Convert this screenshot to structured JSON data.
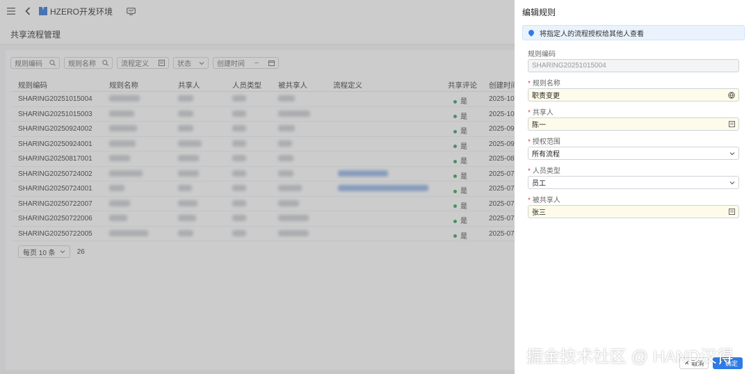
{
  "topbar": {
    "env_name": "HZERO开发环境"
  },
  "page": {
    "title": "共享流程管理"
  },
  "filters": [
    {
      "label": "规则编码",
      "icon": "search-icon"
    },
    {
      "label": "规则名称",
      "icon": "search-icon"
    },
    {
      "label": "流程定义",
      "icon": "lookup-icon"
    },
    {
      "label": "状态",
      "icon": "chevron-down-icon"
    },
    {
      "label": "创建时间",
      "separator": "–",
      "icon": "calendar-icon"
    }
  ],
  "table": {
    "columns": [
      "规则编码",
      "规则名称",
      "共享人",
      "人员类型",
      "被共享人",
      "流程定义",
      "共享评论",
      "创建时间"
    ],
    "rows": [
      {
        "code": "SHARING20251015004",
        "comment": "是",
        "created": "2025-10-"
      },
      {
        "code": "SHARING20251015003",
        "comment": "是",
        "created": "2025-10-"
      },
      {
        "code": "SHARING20250924002",
        "comment": "是",
        "created": "2025-09-"
      },
      {
        "code": "SHARING20250924001",
        "comment": "是",
        "created": "2025-09-"
      },
      {
        "code": "SHARING20250817001",
        "comment": "是",
        "created": "2025-08-"
      },
      {
        "code": "SHARING20250724002",
        "comment": "是",
        "created": "2025-07-"
      },
      {
        "code": "SHARING20250724001",
        "comment": "是",
        "created": "2025-07-"
      },
      {
        "code": "SHARING20250722007",
        "comment": "是",
        "created": "2025-07-"
      },
      {
        "code": "SHARING20250722006",
        "comment": "是",
        "created": "2025-07-"
      },
      {
        "code": "SHARING20250722005",
        "comment": "是",
        "created": "2025-07-"
      }
    ]
  },
  "pagination": {
    "page_size_label": "每页 10 条",
    "total": "26"
  },
  "drawer": {
    "title": "编辑规则",
    "notice": "将指定人的流程授权给其他人查看",
    "fields": [
      {
        "label": "规则编码",
        "value": "SHARING20251015004",
        "required": false
      },
      {
        "label": "规则名称",
        "value": "职责变更",
        "required": true
      },
      {
        "label": "共享人",
        "value": "陈一",
        "required": true
      },
      {
        "label": "授权范围",
        "value": "所有流程",
        "required": true
      },
      {
        "label": "人员类型",
        "value": "员工",
        "required": true
      },
      {
        "label": "被共享人",
        "value": "张三",
        "required": true
      }
    ],
    "cancel_label": "取消",
    "ok_label": "确定"
  },
  "watermark": "掘金技术社区 @ HAND汉得",
  "colors": {
    "primary": "#2f7be5",
    "status_green": "#2e9d5b",
    "required_red": "#e04848"
  }
}
